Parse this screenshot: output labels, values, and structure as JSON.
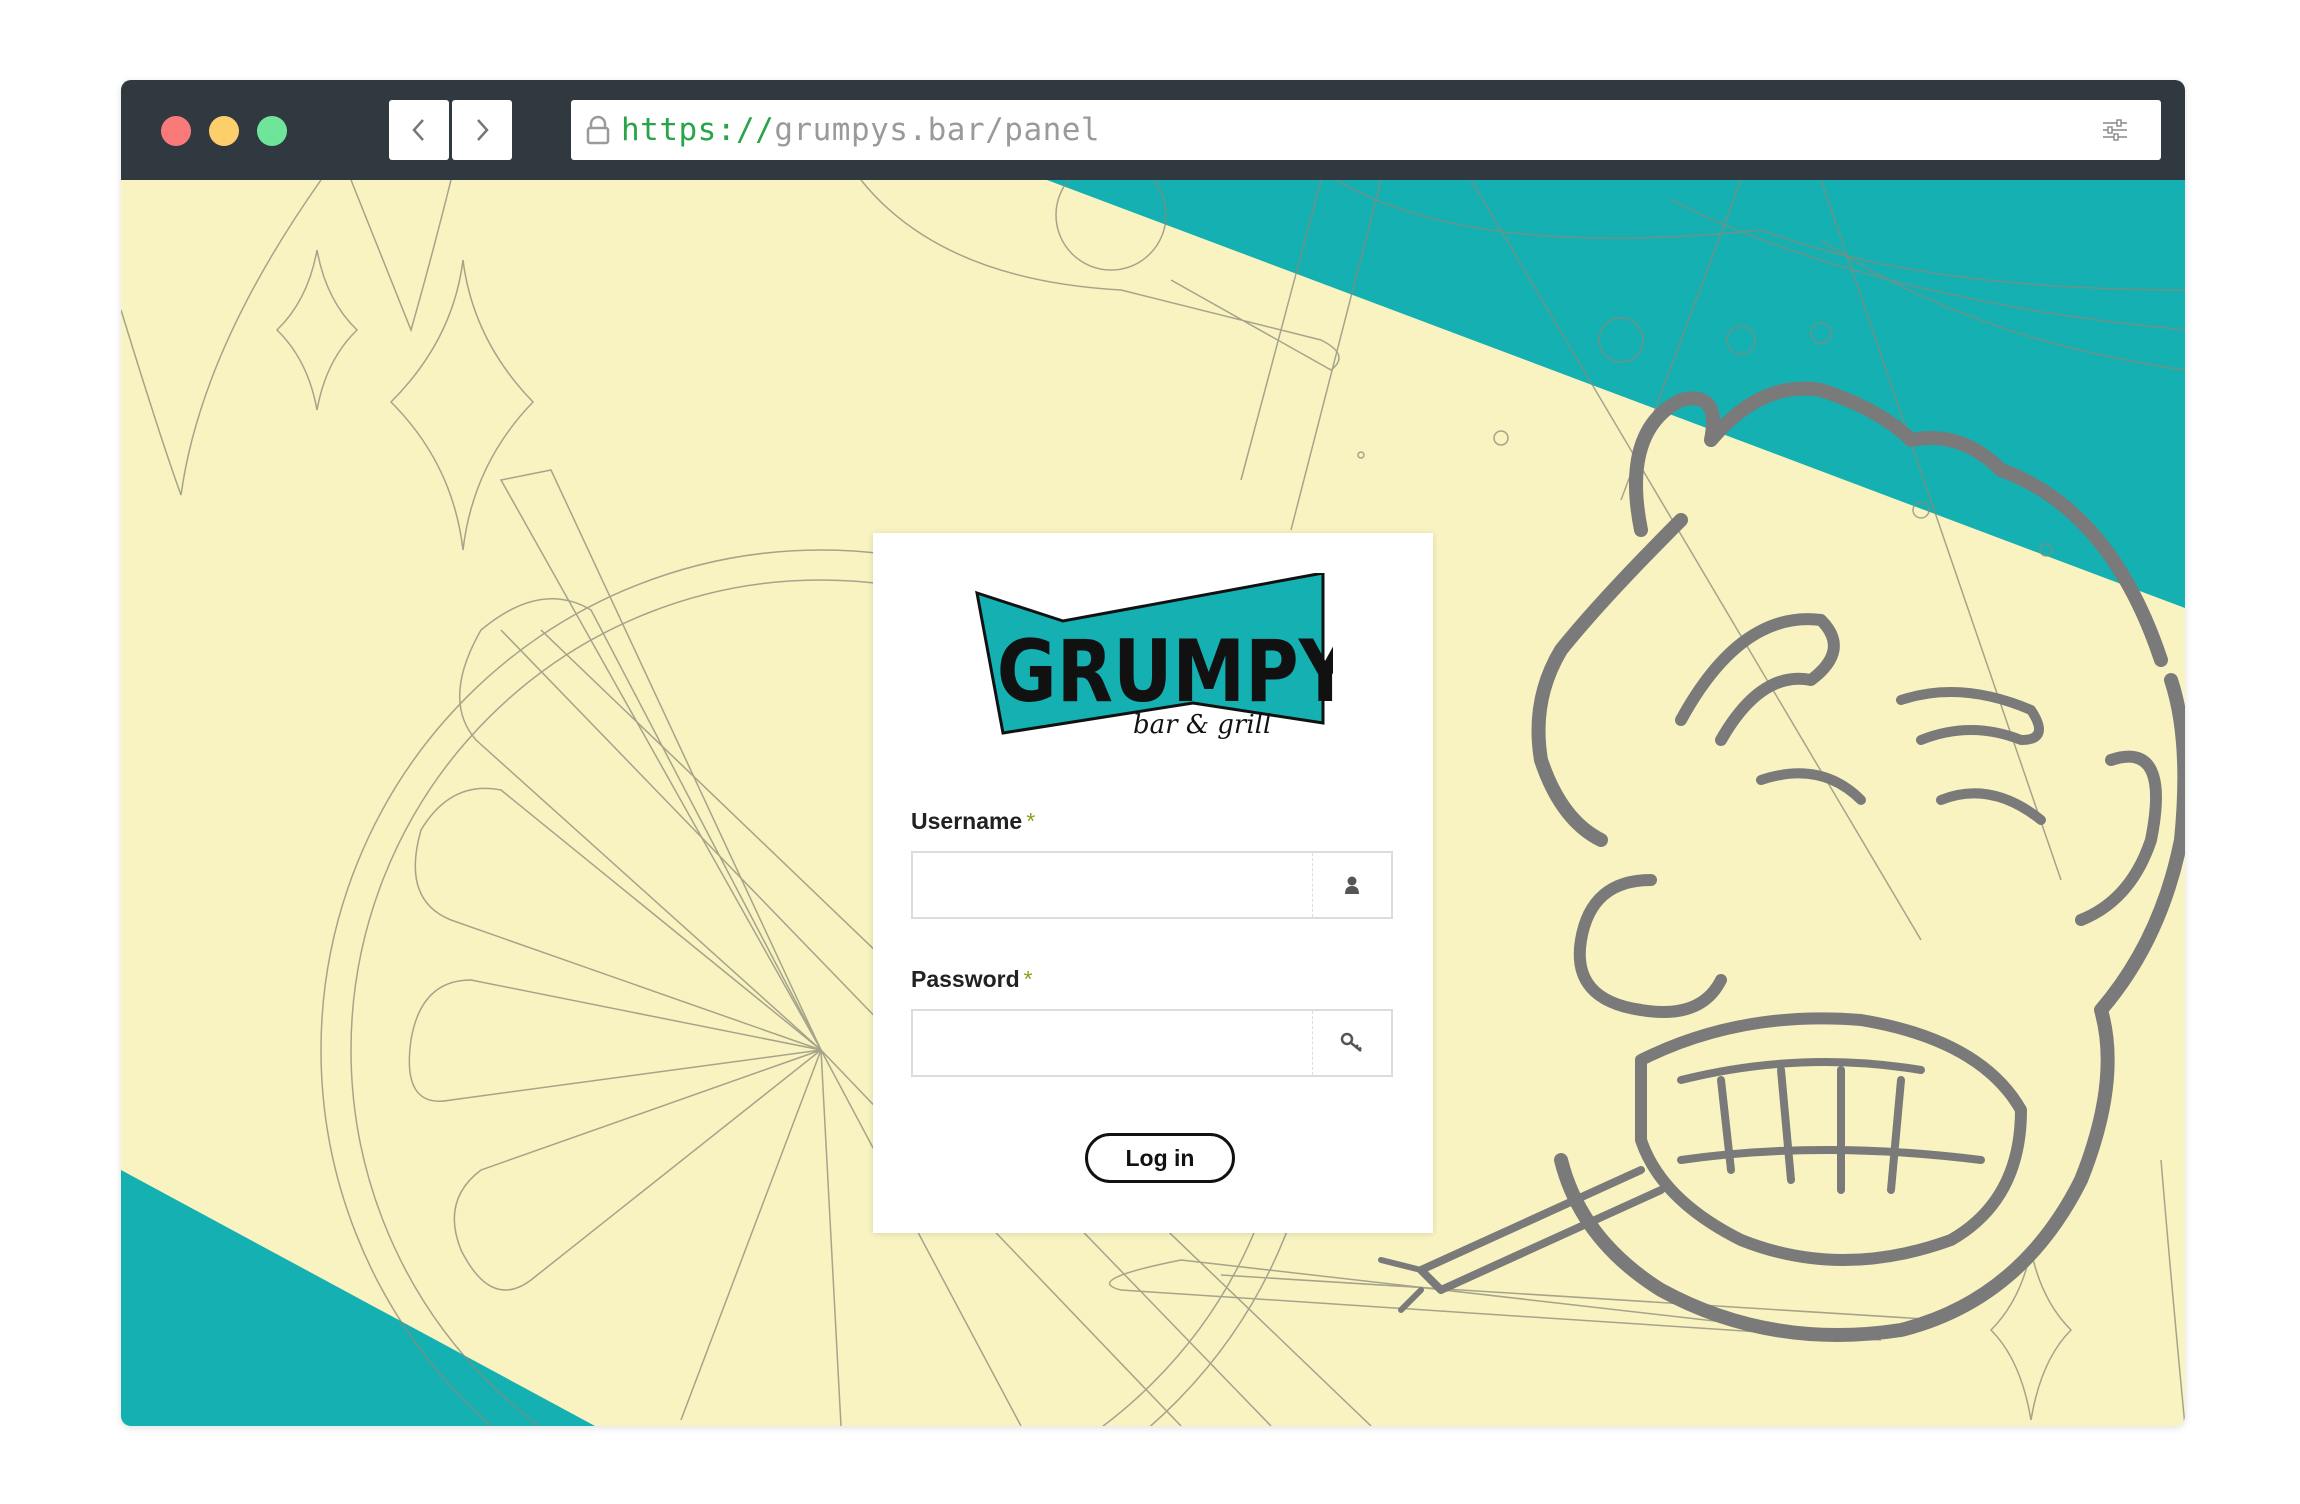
{
  "browser": {
    "url_scheme": "https://",
    "url_host": "grumpys.bar/panel"
  },
  "login": {
    "logo_text": "GRUMPY'S",
    "logo_subtext": "bar & grill",
    "username_label": "Username",
    "password_label": "Password",
    "required_marker": "*",
    "login_button": "Log in"
  },
  "colors": {
    "background": "#f8f3c0",
    "teal": "#14b0b2",
    "titlebar": "#303840"
  },
  "icons": {
    "username_addon": "user-icon",
    "password_addon": "key-icon",
    "settings": "sliders-icon"
  }
}
